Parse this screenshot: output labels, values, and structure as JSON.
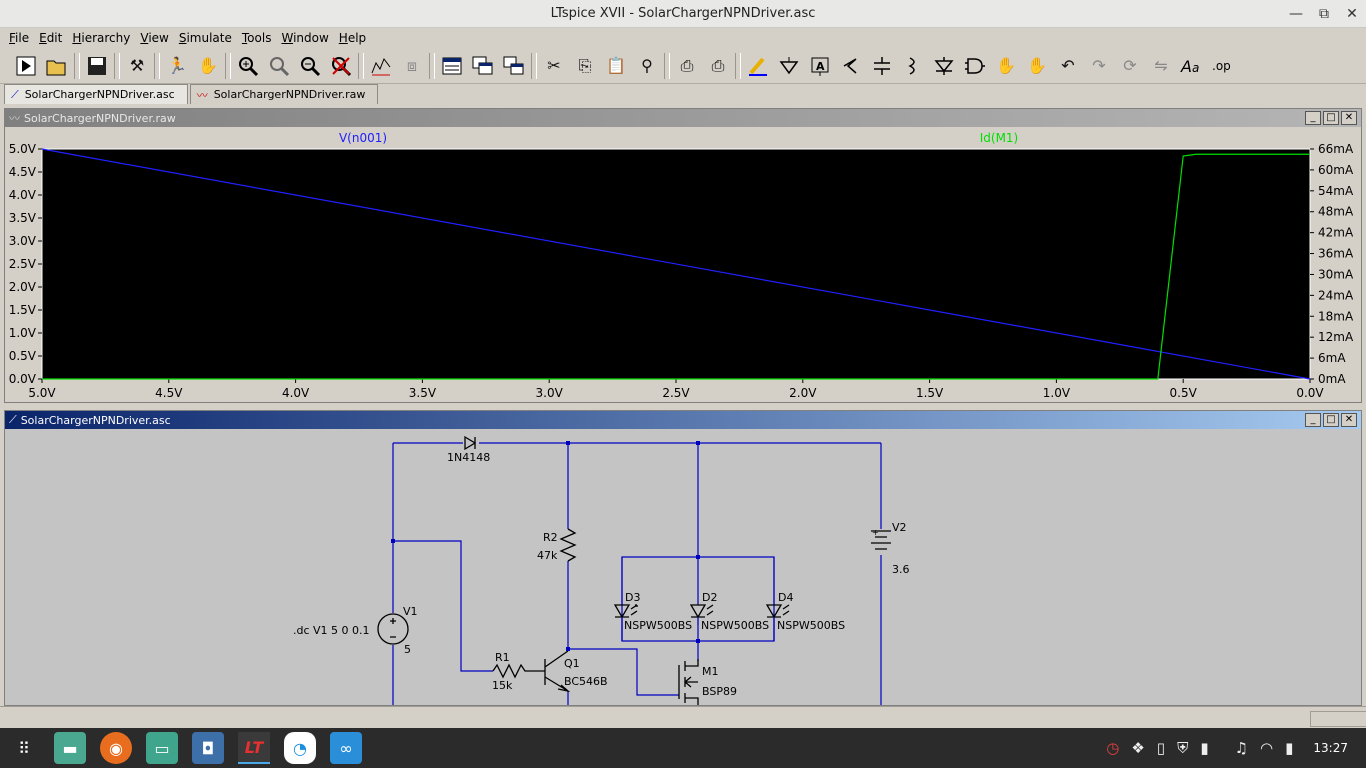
{
  "window": {
    "title": "LTspice XVII - SolarChargerNPNDriver.asc",
    "controls": {
      "minimize": "—",
      "restore": "⧉",
      "close": "✕"
    }
  },
  "menu": [
    "File",
    "Edit",
    "Hierarchy",
    "View",
    "Simulate",
    "Tools",
    "Window",
    "Help"
  ],
  "toolbar": {
    "icons": [
      "run-icon",
      "open-icon",
      "save-icon",
      "control-panel-icon",
      "halt-icon",
      "pan-hand-icon",
      "zoom-in-icon",
      "zoom-full-icon",
      "zoom-out-icon",
      "zoom-cancel-icon",
      "tile-icon",
      "cascade-icon",
      "new-window-icon",
      "window-list-icon",
      "window-arrange-icon",
      "cut-icon",
      "copy-icon",
      "paste-icon",
      "find-icon",
      "print-icon",
      "print-setup-icon",
      "draw-wire-icon",
      "ground-icon",
      "label-net-icon",
      "resistor-icon",
      "capacitor-icon",
      "inductor-icon",
      "diode-icon",
      "component-icon",
      "move-icon",
      "drag-icon",
      "undo-icon",
      "redo-icon",
      "rotate-icon",
      "mirror-icon",
      "text-icon",
      "spice-directive-icon"
    ]
  },
  "tabs": [
    {
      "label": "SolarChargerNPNDriver.asc",
      "icon": "schematic-icon",
      "active": true
    },
    {
      "label": "SolarChargerNPNDriver.raw",
      "icon": "waveform-icon",
      "active": false
    }
  ],
  "plot_window": {
    "title": "SolarChargerNPNDriver.raw",
    "chart_data": {
      "type": "line",
      "title": "",
      "x_ticks": [
        "5.0V",
        "4.5V",
        "4.0V",
        "3.5V",
        "3.0V",
        "2.5V",
        "2.0V",
        "1.5V",
        "1.0V",
        "0.5V",
        "0.0V"
      ],
      "y_left_ticks": [
        "5.0V",
        "4.5V",
        "4.0V",
        "3.5V",
        "3.0V",
        "2.5V",
        "2.0V",
        "1.5V",
        "1.0V",
        "0.5V",
        "0.0V"
      ],
      "y_right_ticks": [
        "66mA",
        "60mA",
        "54mA",
        "48mA",
        "42mA",
        "36mA",
        "30mA",
        "24mA",
        "18mA",
        "12mA",
        "6mA",
        "0mA"
      ],
      "xlim": [
        5.0,
        0.0
      ],
      "ylim_left": [
        0,
        5.0
      ],
      "ylim_right": [
        0,
        66
      ],
      "grid": false,
      "background": "#000000",
      "series": [
        {
          "name": "V(n001)",
          "color": "#2020ff",
          "axis": "left",
          "x": [
            5.0,
            0.0
          ],
          "y": [
            5.0,
            0.0
          ]
        },
        {
          "name": "Id(M1)",
          "color": "#00e000",
          "axis": "right",
          "x": [
            5.0,
            0.6,
            0.5,
            0.45,
            0.0
          ],
          "y": [
            0,
            0,
            64,
            64.5,
            64.5
          ]
        }
      ]
    }
  },
  "schematic_window": {
    "title": "SolarChargerNPNDriver.asc",
    "labels": {
      "d_top": "1N4148",
      "r2_name": "R2",
      "r2_val": "47k",
      "v2_name": "V2",
      "v2_val": "3.6",
      "v2_plus": "+",
      "v1_name": "V1",
      "v1_val": "5",
      "directive": ".dc V1 5 0 0.1",
      "r1_name": "R1",
      "r1_val": "15k",
      "q1_name": "Q1",
      "q1_val": "BC546B",
      "m1_name": "M1",
      "m1_val": "BSP89",
      "d3_name": "D3",
      "d3_val": "NSPW500BS",
      "d2_name": "D2",
      "d2_val": "NSPW500BS",
      "d4_name": "D4",
      "d4_val": "NSPW500BS"
    },
    "colors": {
      "wire": "#0000c0",
      "component": "#000000",
      "background": "#c4c4c4"
    }
  },
  "taskbar": {
    "apps": [
      "app-grid-icon",
      "files-icon",
      "firefox-icon",
      "folder-icon",
      "screenshot-icon",
      "ltspice-icon",
      "browser-icon",
      "glasses-icon"
    ],
    "tray_icons": [
      "clock-icon",
      "dropbox-icon",
      "clipboard-icon",
      "shield-icon",
      "battery-lock-icon",
      "music-icon",
      "wifi-icon",
      "battery-icon"
    ],
    "clock": "13:27"
  }
}
